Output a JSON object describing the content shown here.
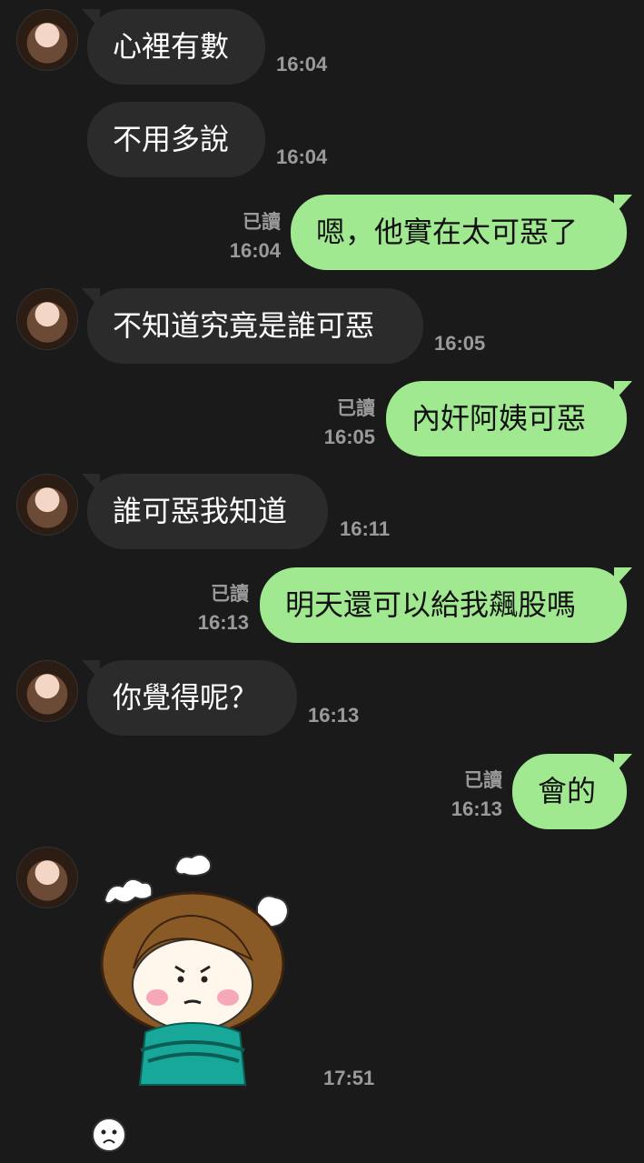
{
  "messages": [
    {
      "side": "in",
      "text": "心裡有數",
      "time": "16:04"
    },
    {
      "side": "in",
      "text": "不用多說",
      "time": "16:04"
    },
    {
      "side": "out",
      "text": "嗯，他實在太可惡了",
      "read": "已讀",
      "time": "16:04"
    },
    {
      "side": "in",
      "text": "不知道究竟是誰可惡",
      "time": "16:05"
    },
    {
      "side": "out",
      "text": "內奸阿姨可惡",
      "read": "已讀",
      "time": "16:05"
    },
    {
      "side": "in",
      "text": "誰可惡我知道",
      "time": "16:11"
    },
    {
      "side": "out",
      "text": "明天還可以給我飆股嗎",
      "read": "已讀",
      "time": "16:13"
    },
    {
      "side": "in",
      "text": "你覺得呢？",
      "time": "16:13"
    },
    {
      "side": "out",
      "text": "會的",
      "read": "已讀",
      "time": "16:13"
    },
    {
      "side": "in",
      "sticker": "angry-girl-sticker",
      "time": "17:51"
    }
  ],
  "colors": {
    "background": "#1a1a1a",
    "incoming_bubble": "#2b2b2b",
    "outgoing_bubble": "#a1e990",
    "timestamp": "#9a9a9a"
  }
}
